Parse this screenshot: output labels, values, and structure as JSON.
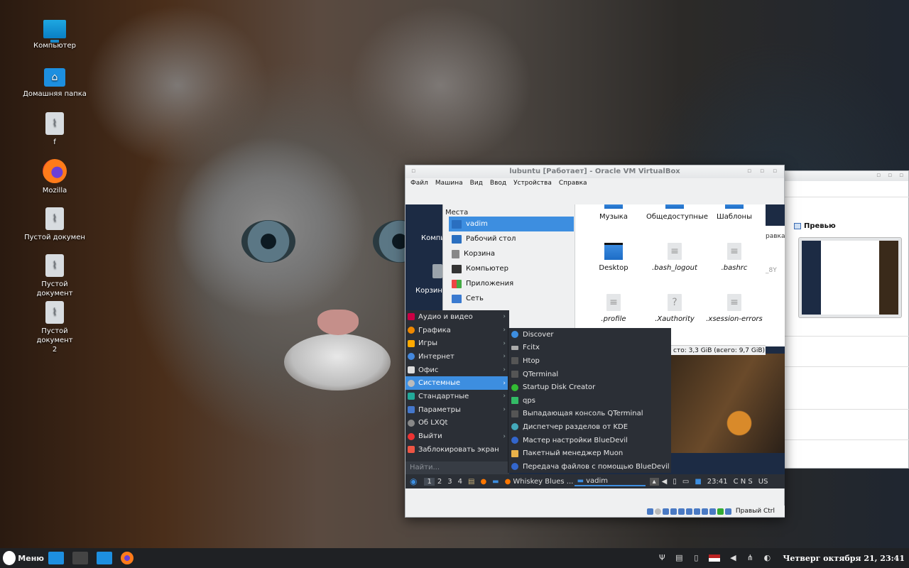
{
  "desktop_icons": [
    {
      "label": "Компьютер",
      "icon": "computer-icon"
    },
    {
      "label": "Домашняя папка",
      "icon": "home-folder-icon"
    },
    {
      "label": "f",
      "icon": "document-icon"
    },
    {
      "label": "Mozilla",
      "icon": "firefox-icon"
    },
    {
      "label": "Пустой докумен",
      "icon": "document-icon"
    },
    {
      "label": "Пустой документ",
      "icon": "document-icon"
    },
    {
      "label": "Пустой документ 2",
      "icon": "document-icon"
    }
  ],
  "vbox": {
    "title": "lubuntu [Работает] - Oracle VM VirtualBox",
    "menu": [
      "Файл",
      "Машина",
      "Вид",
      "Ввод",
      "Устройства",
      "Справка"
    ],
    "status_key": "Правый Ctrl"
  },
  "guest_desktop": {
    "icon1": "Компь",
    "icon2": "Корзина"
  },
  "file_manager": {
    "places_header": "Места",
    "places": [
      "vadim",
      "Рабочий стол",
      "Корзина",
      "Компьютер",
      "Приложения",
      "Сеть"
    ],
    "files": [
      "Музыка",
      "Общедоступные",
      "Шаблоны",
      "Desktop",
      ".bash_logout",
      ".bashrc",
      ".profile",
      ".Xauthority",
      ".xsession-errors"
    ],
    "status": "сто: 3,3 GiB (всего: 9,7 GiB)",
    "partial_left": "равка",
    "partial_left2": "_8Y"
  },
  "lxqt_menu": {
    "items": [
      "Аудио и видео",
      "Графика",
      "Игры",
      "Интернет",
      "Офис",
      "Системные",
      "Стандартные",
      "Параметры",
      "Об LXQt",
      "Выйти",
      "Заблокировать экран"
    ],
    "search_placeholder": "Найти...",
    "submenu": [
      "Discover",
      "Fcitx",
      "Htop",
      "QTerminal",
      "Startup Disk Creator",
      "qps",
      "Выпадающая консоль QTerminal",
      "Диспетчер разделов от KDE",
      "Мастер настройки BlueDevil",
      "Пакетный менеджер Muon",
      "Передача файлов с помощью BlueDevil"
    ]
  },
  "guest_panel": {
    "desktops": [
      "1",
      "2",
      "3",
      "4"
    ],
    "task1": "Whiskey Blues ...",
    "task2": "vadim",
    "clock": "23:41",
    "kbd": "C N S",
    "layout": "US"
  },
  "win2": {
    "preview_label": "Превью"
  },
  "host_panel": {
    "menu_label": "Меню",
    "clock": "Четверг октября 21, 23:41"
  }
}
